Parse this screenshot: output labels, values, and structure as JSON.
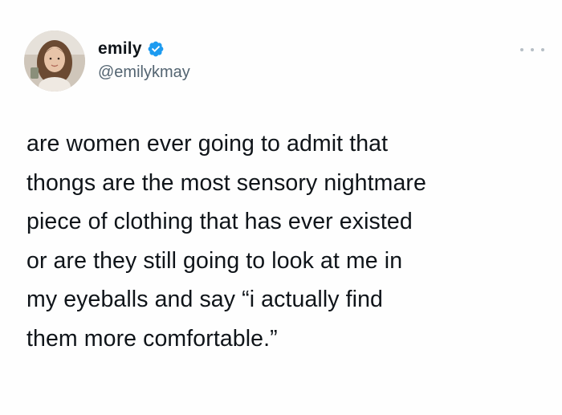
{
  "author": {
    "display_name": "emily",
    "handle": "@emilykmay",
    "verified": true
  },
  "tweet": {
    "text": "are women ever going to admit that\nthongs are the most sensory nightmare\npiece of clothing that has ever existed\nor are they still going to look at me in\nmy eyeballs and say “i actually find\nthem more comfortable.”"
  },
  "icons": {
    "verified": "verified-badge-icon",
    "more": "more-options-icon"
  },
  "colors": {
    "verified_blue": "#1d9bf0",
    "handle_gray": "#536471",
    "text": "#0f1419"
  }
}
